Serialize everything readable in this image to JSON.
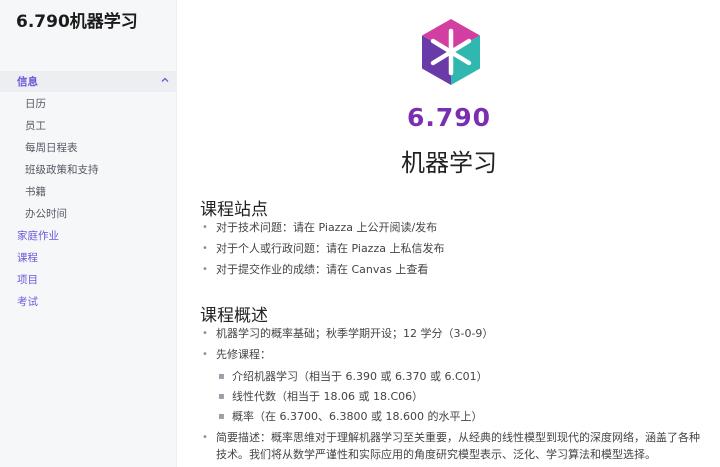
{
  "sidebar": {
    "title": "6.790机器学习",
    "items": [
      {
        "label": "信息",
        "active": true
      },
      {
        "label": "日历"
      },
      {
        "label": "员工"
      },
      {
        "label": "每周日程表"
      },
      {
        "label": "班级政策和支持"
      },
      {
        "label": "书籍"
      },
      {
        "label": "办公时间"
      },
      {
        "label": "家庭作业"
      },
      {
        "label": "课程"
      },
      {
        "label": "项目"
      },
      {
        "label": "考试"
      }
    ],
    "chevron_icon": "chevron-up-icon"
  },
  "main": {
    "logo_icon": "course-cube-logo",
    "course_number": "6.790",
    "course_name": "机器学习",
    "sections": [
      {
        "heading": "课程站点",
        "items": [
          "对于技术问题：请在 Piazza 上公开阅读/发布",
          "对于个人或行政问题：请在 Piazza 上私信发布",
          "对于提交作业的成绩：请在 Canvas 上查看"
        ]
      },
      {
        "heading": "课程概述",
        "items": [
          "机器学习的概率基础；秋季学期开设；12 学分（3-0-9）",
          "先修课程：",
          "简要描述：概率思维对于理解机器学习至关重要，从经典的线性模型到现代的深度网络，涵盖了各种",
          "技术。我们将从数学严谨性和实际应用的角度研究模型表示、泛化、学习算法和模型选择。"
        ],
        "prerequisites": [
          "介绍机器学习（相当于 6.390 或 6.370 或 6.C01）",
          "线性代数（相当于 18.06 或 18.C06）",
          "概率（在 6.3700、6.3800 或 18.600 的水平上）"
        ]
      }
    ]
  },
  "colors": {
    "accent": "#6b59d6",
    "logo_magenta": "#d23fa0",
    "logo_purple": "#6a3aa8",
    "logo_teal": "#2fb7b0",
    "sidebar_bg": "#f6f7f9"
  }
}
